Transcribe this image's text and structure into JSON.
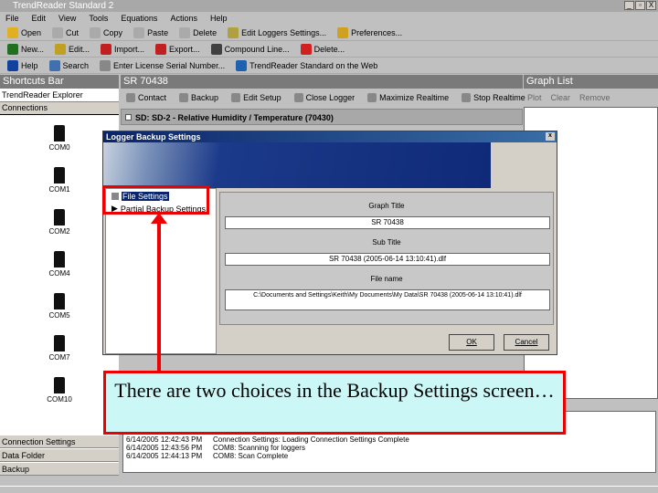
{
  "app": {
    "title": "TrendReader Standard 2",
    "win_buttons": [
      "_",
      "▫",
      "X"
    ]
  },
  "menu": [
    "File",
    "Edit",
    "View",
    "Tools",
    "Equations",
    "Actions",
    "Help"
  ],
  "toolbar1": [
    {
      "label": "Open",
      "color": "#e0b020"
    },
    {
      "label": "Cut",
      "color": "#aaaaaa"
    },
    {
      "label": "Copy",
      "color": "#aaaaaa"
    },
    {
      "label": "Paste",
      "color": "#aaaaaa"
    },
    {
      "label": "Delete",
      "color": "#aaaaaa"
    },
    {
      "label": "Edit Loggers Settings...",
      "color": "#b0a040"
    },
    {
      "label": "Preferences...",
      "color": "#d0a020"
    }
  ],
  "toolbar2": [
    {
      "label": "New...",
      "color": "#207020"
    },
    {
      "label": "Edit...",
      "color": "#c0a020"
    },
    {
      "label": "Import...",
      "color": "#c02020"
    },
    {
      "label": "Export...",
      "color": "#c02020"
    },
    {
      "label": "Compound Line...",
      "color": "#404040"
    },
    {
      "label": "Delete...",
      "color": "#d02020"
    }
  ],
  "toolbar3": [
    {
      "label": "Help",
      "color": "#1040a0"
    },
    {
      "label": "Search",
      "color": "#4070b0"
    },
    {
      "label": "Enter License Serial Number...",
      "color": "#888888"
    },
    {
      "label": "TrendReader Standard on the Web",
      "color": "#2060b0"
    }
  ],
  "shortcuts": {
    "title": "Shortcuts Bar",
    "explorer": "TrendReader Explorer",
    "connections": "Connections",
    "ports": [
      "COM0",
      "COM1",
      "COM2",
      "COM4",
      "COM5",
      "COM7",
      "COM10"
    ],
    "buttons": [
      "Connection Settings",
      "Data Folder",
      "Backup"
    ]
  },
  "logger": {
    "title": "SR 70438",
    "toolbar": [
      "Contact",
      "Backup",
      "Edit Setup",
      "Close Logger",
      "Maximize Realtime",
      "Stop Realtime"
    ],
    "item": "SD: SD-2 - Relative Humidity / Temperature (70430)"
  },
  "graph_list": {
    "title": "Graph List",
    "toolbar": [
      "Plot",
      "Clear",
      "Remove"
    ]
  },
  "dialog": {
    "title": "Logger Backup Settings",
    "close": "x",
    "tree": [
      "File Settings",
      "Partial Backup Settings"
    ],
    "graph_title_label": "Graph Title",
    "graph_title": "SR 70438",
    "sub_title_label": "Sub Title",
    "sub_title": "SR 70438 (2005-06-14 13:10:41).dlf",
    "filename_label": "File name",
    "filename": "C:\\Documents and Settings\\Keith\\My Documents\\My Data\\SR 70438 (2005-06-14 13:10:41).dlf",
    "ok": "OK",
    "cancel": "Cancel"
  },
  "log": [
    {
      "time": "6/14/2005 12:42:43 PM",
      "msg": "Connection Settings: Loading Connection Settings Complete"
    },
    {
      "time": "6/14/2005 12:43:56 PM",
      "msg": "COM8: Scanning for loggers"
    },
    {
      "time": "6/14/2005 12:44:13 PM",
      "msg": "COM8: Scan Complete"
    }
  ],
  "callout": "There are two choices in the Backup Settings screen…"
}
